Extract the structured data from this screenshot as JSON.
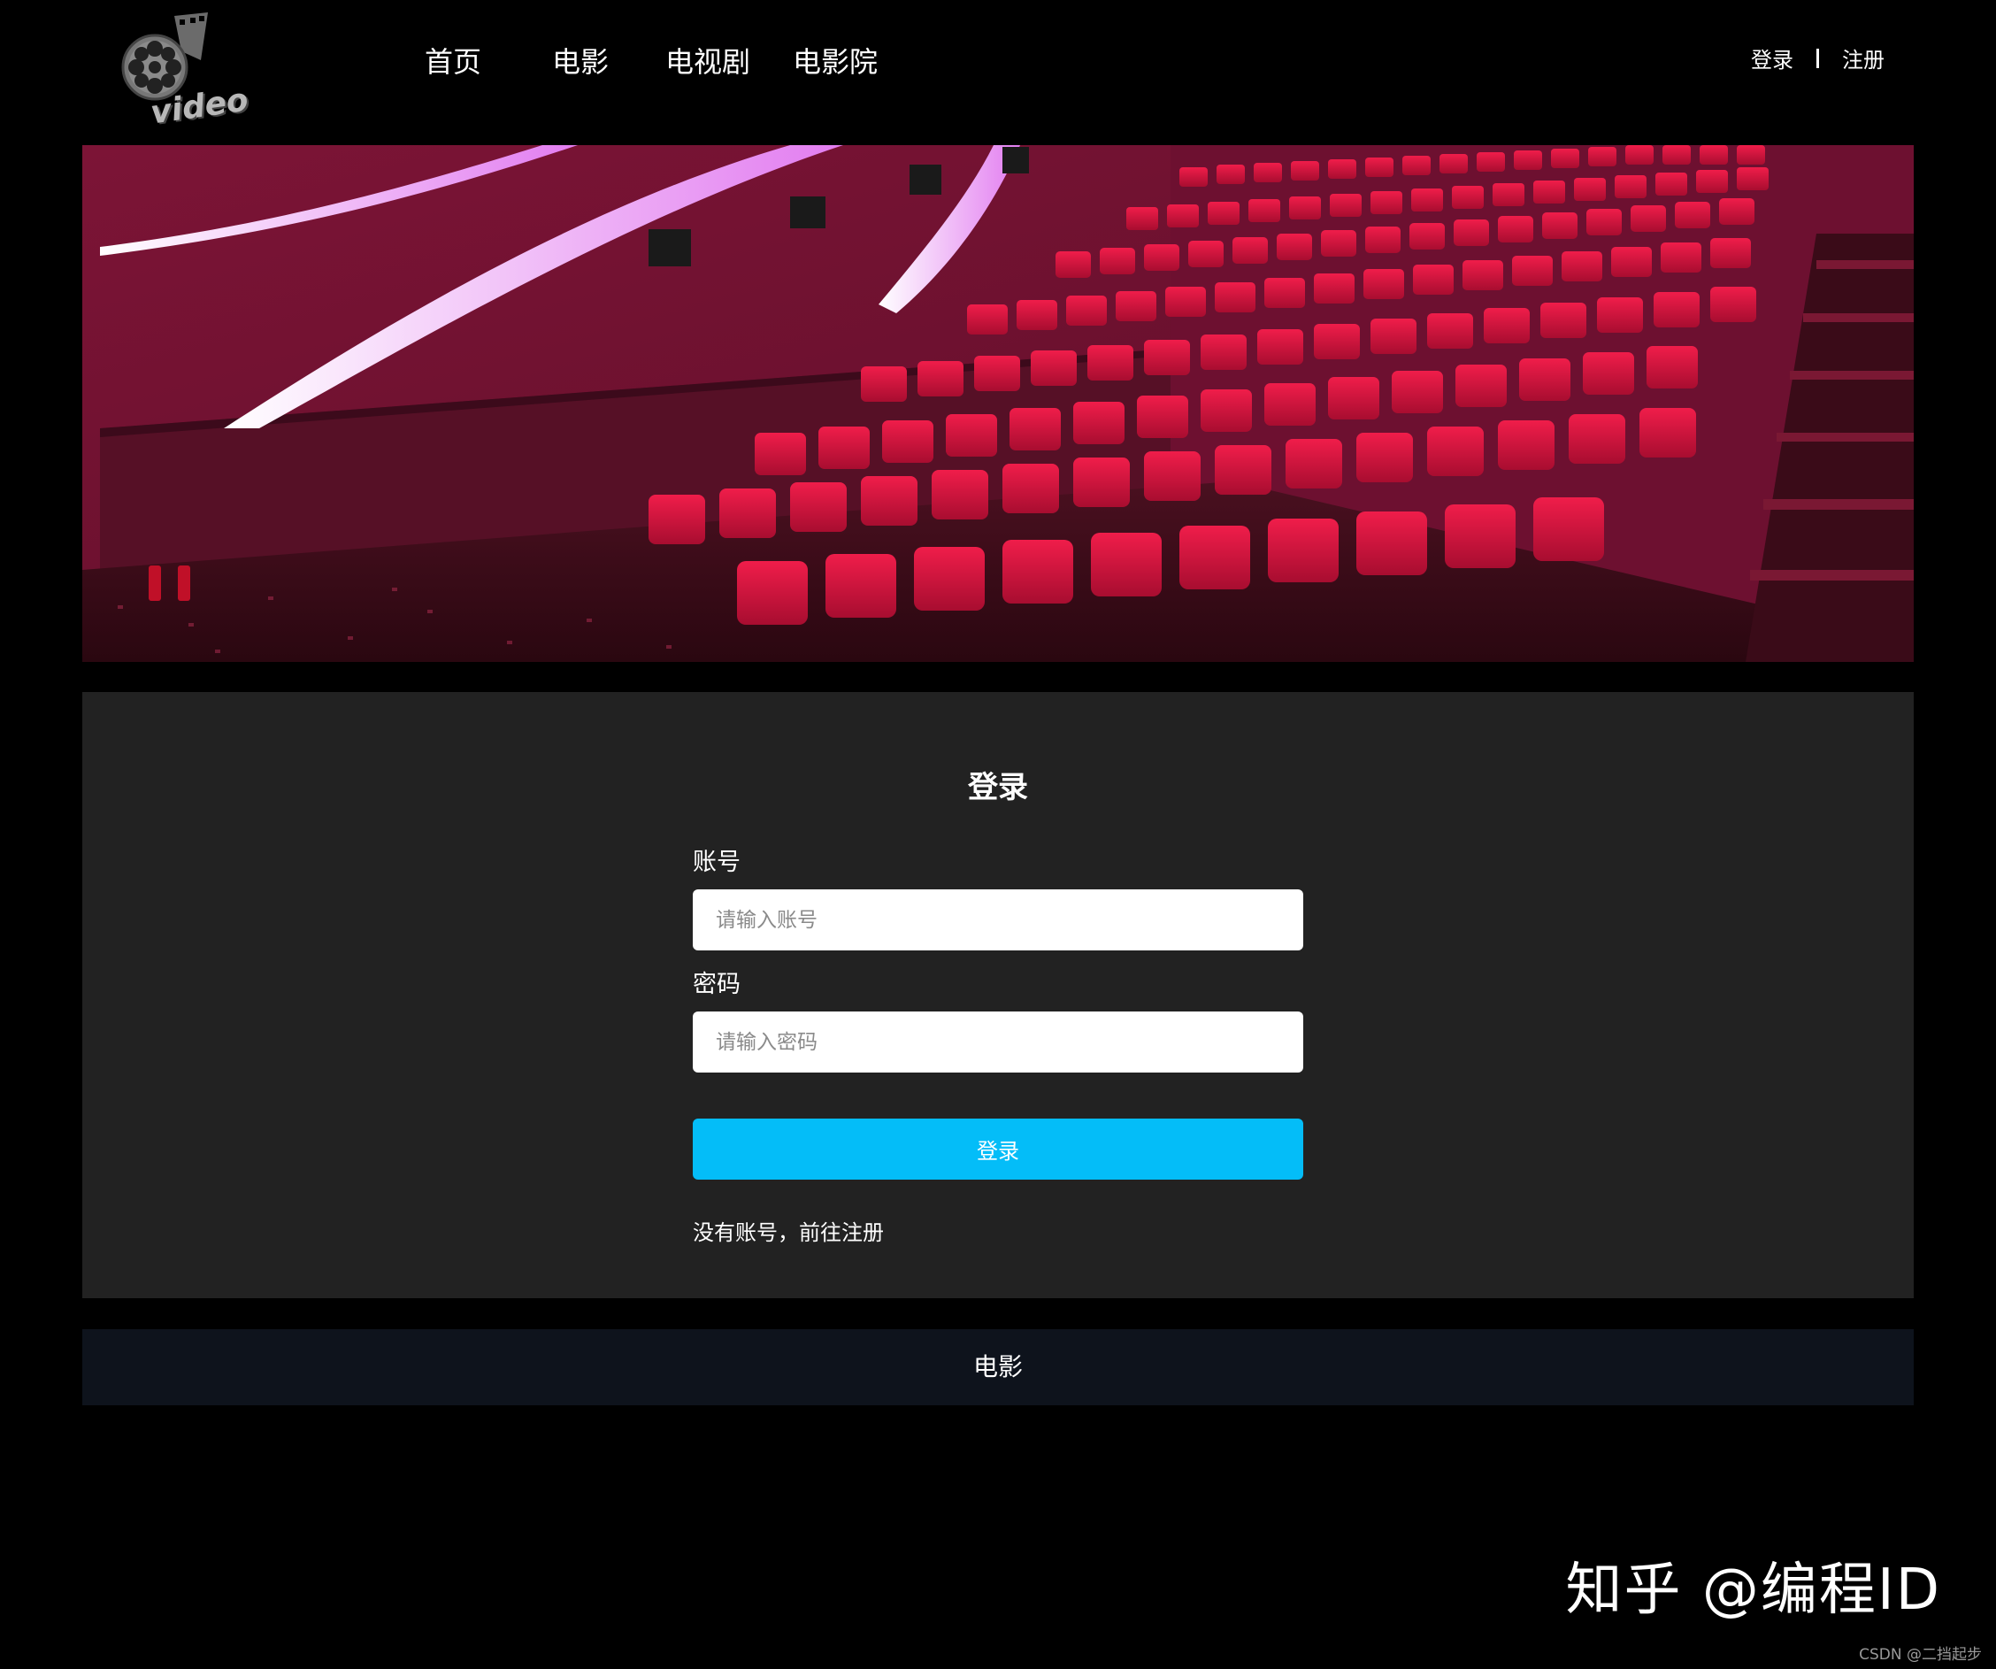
{
  "logo": {
    "text": "video"
  },
  "nav": {
    "items": [
      {
        "label": "首页"
      },
      {
        "label": "电影"
      },
      {
        "label": "电视剧"
      },
      {
        "label": "电影院"
      }
    ]
  },
  "auth": {
    "login": "登录",
    "register": "注册"
  },
  "login_form": {
    "title": "登录",
    "account_label": "账号",
    "account_placeholder": "请输入账号",
    "account_value": "",
    "password_label": "密码",
    "password_placeholder": "请输入密码",
    "password_value": "",
    "submit_label": "登录",
    "register_prompt": "没有账号，前往注册"
  },
  "footer": {
    "text": "电影"
  },
  "watermarks": {
    "zhihu": "知乎 @编程ID",
    "csdn": "CSDN @二挡起步"
  },
  "colors": {
    "background": "#000000",
    "panel": "#222222",
    "accent_button": "#04bdf8",
    "footer_bar": "#0e131c",
    "seat_red": "#d4163f"
  }
}
